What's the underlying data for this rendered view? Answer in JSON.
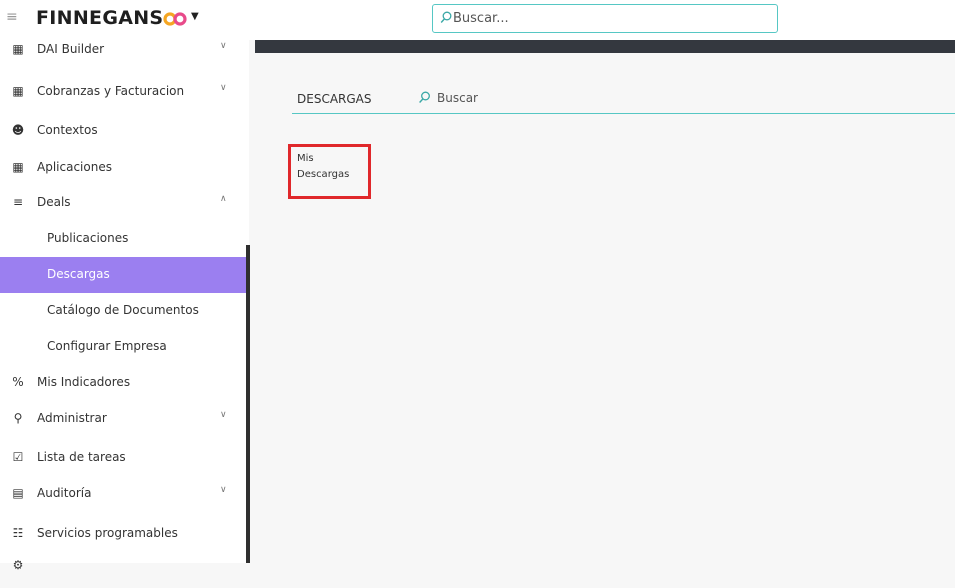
{
  "header": {
    "brand": "FINNEGANS",
    "logo_icon": "infinity-logo",
    "logo_colors": [
      "#f5a623",
      "#e84a8a"
    ],
    "search_placeholder": "Buscar..."
  },
  "sidebar": {
    "accent_color": "#9b7ff0",
    "items": [
      {
        "label": "DAI Builder",
        "icon": "building-icon",
        "chevron": "down"
      },
      {
        "label": "Cobranzas y Facturacion",
        "icon": "building-icon",
        "chevron": "down"
      },
      {
        "label": "Contextos",
        "icon": "users-icon"
      },
      {
        "label": "Aplicaciones",
        "icon": "grid-icon"
      },
      {
        "label": "Deals",
        "icon": "stack-icon",
        "chevron": "up"
      },
      {
        "label": "Publicaciones",
        "sub": true
      },
      {
        "label": "Descargas",
        "sub": true,
        "active": true
      },
      {
        "label": "Catálogo de Documentos",
        "sub": true
      },
      {
        "label": "Configurar Empresa",
        "sub": true
      },
      {
        "label": "Mis Indicadores",
        "icon": "percent-icon"
      },
      {
        "label": "Administrar",
        "icon": "user-gear-icon",
        "chevron": "down"
      },
      {
        "label": "Lista de tareas",
        "icon": "clipboard-check-icon"
      },
      {
        "label": "Auditoría",
        "icon": "archive-icon",
        "chevron": "down"
      },
      {
        "label": "Servicios programables",
        "icon": "network-icon"
      }
    ]
  },
  "main": {
    "tab_label": "DESCARGAS",
    "search_placeholder": "Buscar",
    "card": {
      "line1": "Mis",
      "line2": "Descargas"
    }
  }
}
